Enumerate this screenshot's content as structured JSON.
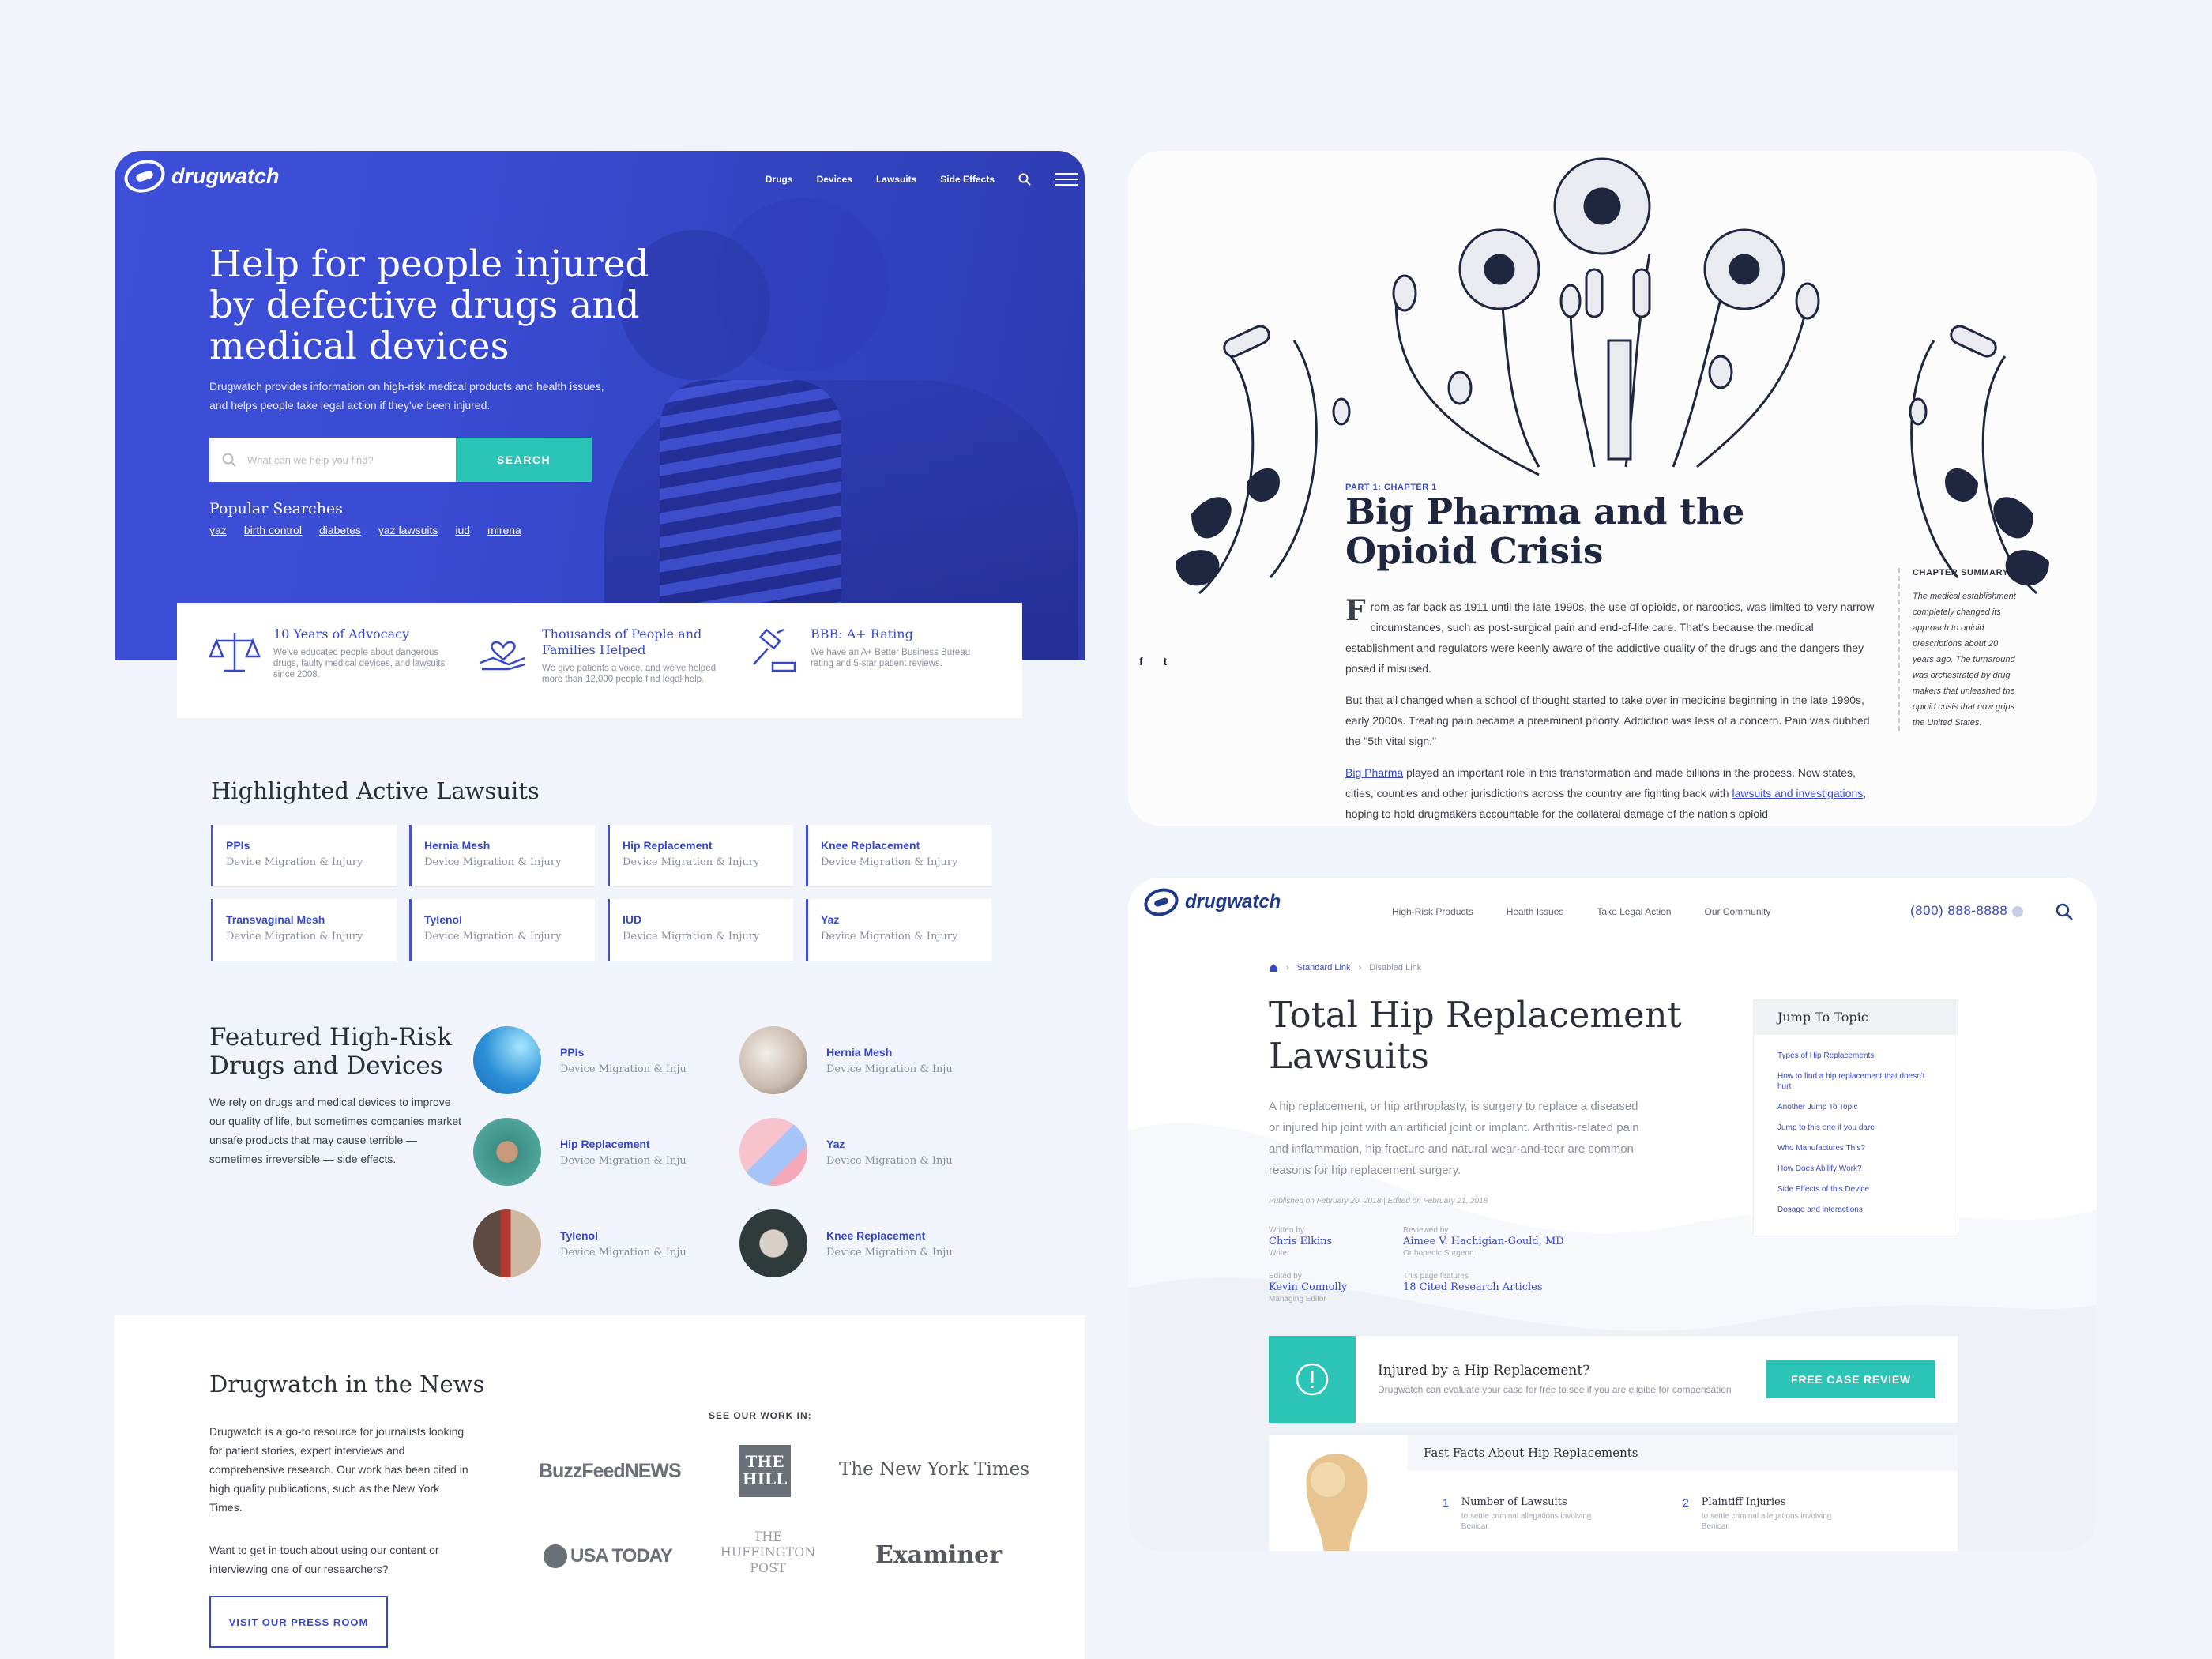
{
  "home": {
    "brand": "drugwatch",
    "nav": [
      "Drugs",
      "Devices",
      "Lawsuits",
      "Side Effects"
    ],
    "hero_title": "Help for people injured by defective drugs and medical devices",
    "hero_text": "Drugwatch provides information on high-risk medical products and health issues, and helps people take legal action if they've been injured.",
    "search_placeholder": "What can we help you find?",
    "search_button": "SEARCH",
    "popular_title": "Popular Searches",
    "popular": [
      "yaz",
      "birth control",
      "diabetes",
      "yaz lawsuits",
      "iud",
      "mirena"
    ],
    "stats": [
      {
        "title": "10 Years of Advocacy",
        "text": "We've educated people about dangerous drugs, faulty medical devices, and lawsuits since 2008.",
        "icon": "scales-icon"
      },
      {
        "title": "Thousands of People and Families Helped",
        "text": "We give patients a voice, and we've helped more than 12,000 people find legal help.",
        "icon": "helping-hands-icon"
      },
      {
        "title": "BBB: A+ Rating",
        "text": "We have an A+ Better Business Bureau rating and 5-star patient reviews.",
        "icon": "gavel-icon"
      }
    ],
    "lawsuits_title": "Highlighted Active Lawsuits",
    "lawsuits": [
      {
        "name": "PPIs",
        "sub": "Device Migration & Injury"
      },
      {
        "name": "Hernia Mesh",
        "sub": "Device Migration & Injury"
      },
      {
        "name": "Hip Replacement",
        "sub": "Device Migration & Injury"
      },
      {
        "name": "Knee Replacement",
        "sub": "Device Migration & Injury"
      },
      {
        "name": "Transvaginal Mesh",
        "sub": "Device Migration & Injury"
      },
      {
        "name": "Tylenol",
        "sub": "Device Migration & Injury"
      },
      {
        "name": "IUD",
        "sub": "Device Migration & Injury"
      },
      {
        "name": "Yaz",
        "sub": "Device Migration & Injury"
      }
    ],
    "featured_title": "Featured High-Risk Drugs and Devices",
    "featured_text": "We rely on drugs and medical devices to improve our quality of life, but sometimes companies market unsafe products that may cause terrible — sometimes irreversible — side effects.",
    "featured": [
      {
        "name": "PPIs",
        "sub": "Device Migration & Injury",
        "color": "#2a8fd6"
      },
      {
        "name": "Hernia Mesh",
        "sub": "Device Migration & Injury",
        "color": "#c9b9ad"
      },
      {
        "name": "Hip Replacement",
        "sub": "Device Migration & Injury",
        "color": "#3c8f86"
      },
      {
        "name": "Yaz",
        "sub": "Device Migration & Injury",
        "color": "#f3a9b7"
      },
      {
        "name": "Tylenol",
        "sub": "Device Migration & Injury",
        "color": "#7d6a5e"
      },
      {
        "name": "Knee Replacement",
        "sub": "Device Migration & Injury",
        "color": "#2e3b3a"
      }
    ],
    "news_title": "Drugwatch in the News",
    "news_text1": "Drugwatch is a go-to resource for journalists looking for patient stories, expert interviews and comprehensive research. Our work has been cited in high quality publications, such as the New York Times.",
    "news_text2": "Want to get in touch about using our content or interviewing one of our researchers?",
    "press_button": "VISIT OUR PRESS ROOM",
    "see_work": "SEE OUR WORK IN:",
    "pubs": [
      "BuzzFeedNEWS",
      "THE HILL",
      "The New York Times",
      "USA TODAY",
      "THE HUFFINGTON POST",
      "Examiner"
    ]
  },
  "article": {
    "chapter": "PART 1: CHAPTER 1",
    "title": "Big Pharma and the Opioid Crisis",
    "p1_cap": "F",
    "p1": "rom as far back as 1911 until the late 1990s, the use of opioids, or narcotics, was limited to very narrow circumstances, such as post-surgical pain and end-of-life care. That's because the medical establishment and regulators were keenly aware of the addictive quality of the drugs and the dangers they posed if misused.",
    "p2": "But that all changed when a school of thought started to take over in medicine beginning in the late 1990s, early 2000s. Treating pain became a preeminent priority. Addiction was less of a concern. Pain was dubbed the \"5th vital sign.\"",
    "p3_link": "Big Pharma",
    "p3a": " played an important role in this transformation and made billions in the process. Now states, cities, counties and other jurisdictions across the country are fighting back with ",
    "p3_link2": "lawsuits and investigations",
    "p3b": ", hoping to hold drugmakers accountable for the collateral damage of the nation's opioid",
    "summary_title": "CHAPTER SUMMARY",
    "summary": "The medical establishment completely changed its approach to opioid prescriptions about 20 years ago. The turnaround was orchestrated by drug makers that unleashed the opioid crisis that now grips the United States.",
    "social": [
      "f",
      "t"
    ]
  },
  "hip": {
    "brand": "drugwatch",
    "nav": [
      "High-Risk Products",
      "Health Issues",
      "Take Legal Action",
      "Our Community"
    ],
    "phone": "(800) 888-8888",
    "crumbs": [
      "Standard Link",
      "Disabled Link"
    ],
    "title": "Total Hip Replacement Lawsuits",
    "intro": "A hip replacement, or hip arthroplasty, is surgery to replace a diseased or injured hip joint with an artificial joint or implant. Arthritis-related pain and inflammation, hip fracture and natural wear-and-tear are common reasons for hip replacement surgery.",
    "dates": "Published on February 20, 2018  |  Edited on February 21, 2018",
    "written_label": "Written by",
    "written": "Chris Elkins",
    "written_role": "Writer",
    "reviewed_label": "Reviewed by",
    "reviewed": "Aimee V. Hachigian-Gould, MD",
    "reviewed_role": "Orthopedic Surgeon",
    "edited_label": "Edited by",
    "edited": "Kevin Connolly",
    "edited_role": "Managing Editor",
    "features_label": "This page features",
    "features": "18 Cited Research Articles",
    "toc_title": "Jump To Topic",
    "toc": [
      "Types of Hip Replacements",
      "How to find a hip replacement that doesn't hurt",
      "Another Jump To Topic",
      "Jump to this one if you dare",
      "Who Manufactures This?",
      "How Does Abilify Work?",
      "Side Effects of this Device",
      "Dosage and interactions"
    ],
    "inj_title": "Injured by a Hip Replacement?",
    "inj_text": "Drugwatch can evaluate your case for free to see if you are eligibe for compensation",
    "free_button": "FREE CASE REVIEW",
    "facts_title": "Fast Facts About Hip Replacements",
    "facts": [
      {
        "n": "1",
        "title": "Number of Lawsuits",
        "text": "to settle criminal allegations involving Benicar."
      },
      {
        "n": "2",
        "title": "Plaintiff Injuries",
        "text": "to settle criminal allegations involving Benicar."
      }
    ]
  },
  "colors": {
    "brand_blue": "#3748c7",
    "teal": "#2bc4b6",
    "page_bg": "#f1f4fb"
  }
}
